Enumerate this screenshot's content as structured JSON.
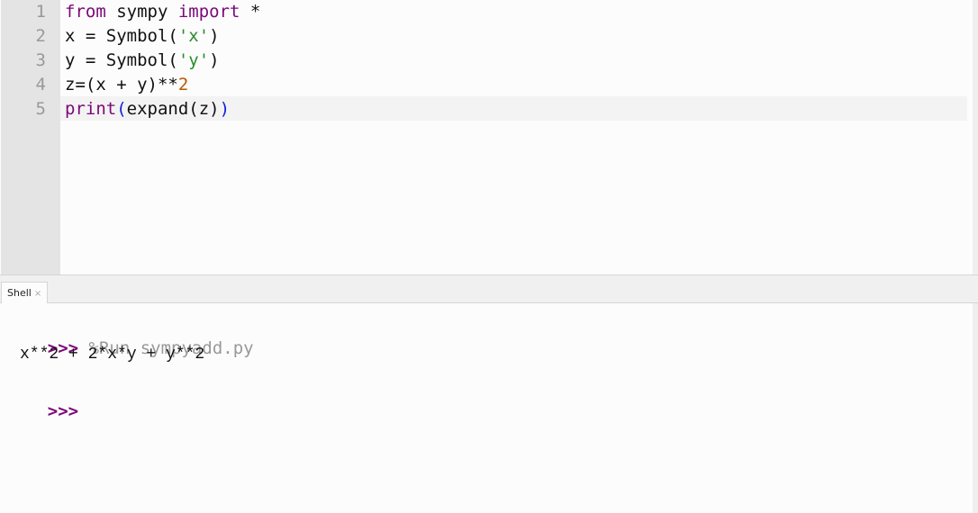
{
  "editor": {
    "lines": [
      {
        "num": "1",
        "tokens": [
          {
            "t": "from",
            "c": "kw"
          },
          {
            "t": " sympy ",
            "c": ""
          },
          {
            "t": "import",
            "c": "kw"
          },
          {
            "t": " *",
            "c": ""
          }
        ]
      },
      {
        "num": "2",
        "tokens": [
          {
            "t": "x = Symbol(",
            "c": ""
          },
          {
            "t": "'x'",
            "c": "str"
          },
          {
            "t": ")",
            "c": ""
          }
        ]
      },
      {
        "num": "3",
        "tokens": [
          {
            "t": "y = Symbol(",
            "c": ""
          },
          {
            "t": "'y'",
            "c": "str"
          },
          {
            "t": ")",
            "c": ""
          }
        ]
      },
      {
        "num": "4",
        "tokens": [
          {
            "t": "z=(x + y)**",
            "c": ""
          },
          {
            "t": "2",
            "c": "num"
          }
        ]
      },
      {
        "num": "5",
        "tokens": [
          {
            "t": "print",
            "c": "kw"
          },
          {
            "t": "(",
            "c": "par1"
          },
          {
            "t": "expand(z)",
            "c": ""
          },
          {
            "t": ")",
            "c": "par1"
          }
        ]
      }
    ]
  },
  "shell": {
    "tab_label": "Shell",
    "tab_close": "×",
    "prompt": ">>>",
    "command": "%Run sympyadd.py",
    "output": "x**2 + 2*x*y + y**2"
  }
}
